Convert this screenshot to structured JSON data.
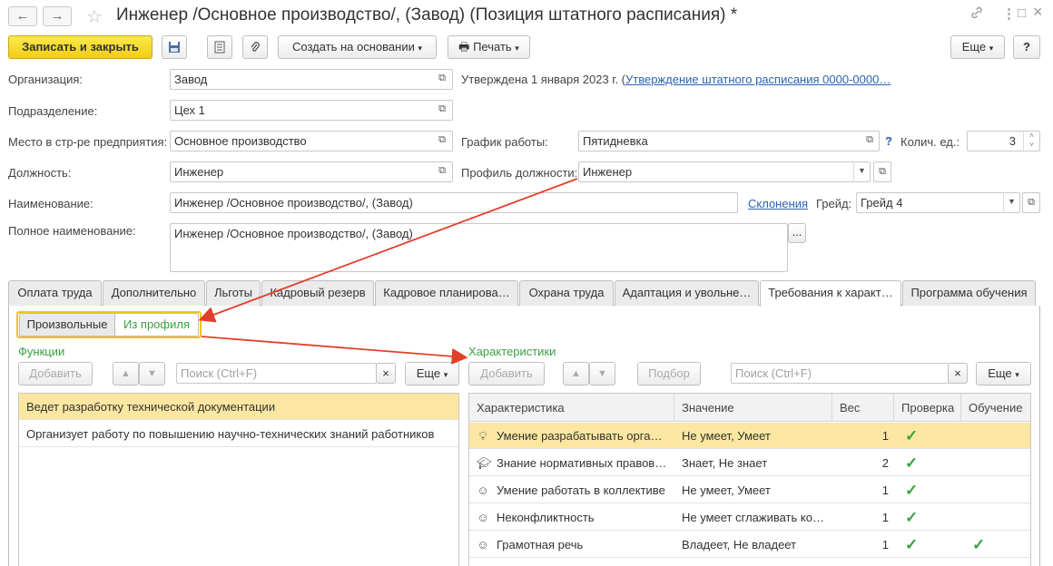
{
  "window": {
    "title": "Инженер /Основное производство/, (Завод) (Позиция штатного расписания) *",
    "back_icon": "←",
    "forward_icon": "→",
    "fav_icon": "☆",
    "link_icon": "🔗",
    "more_icon": "⋮",
    "maximize_icon": "□",
    "close_icon": "×"
  },
  "toolbar": {
    "save_close": "Записать и закрыть",
    "create_based": "Создать на основании",
    "print": "Печать",
    "more": "Еще",
    "help": "?"
  },
  "form": {
    "org_label": "Организация:",
    "org_value": "Завод",
    "approved_text": "Утверждена 1 января 2023 г. (",
    "approved_link": "Утверждение штатного расписания 0000-0000…",
    "dept_label": "Подразделение:",
    "dept_value": "Цех 1",
    "place_label": "Место в стр-ре предприятия:",
    "place_value": "Основное производство",
    "schedule_label": "График работы:",
    "schedule_value": "Пятидневка",
    "units_label": "Колич. ед.:",
    "units_value": "3",
    "position_label": "Должность:",
    "position_value": "Инженер",
    "profile_label": "Профиль должности:",
    "profile_value": "Инженер",
    "name_label": "Наименование:",
    "name_value": "Инженер /Основное производство/, (Завод)",
    "declension_link": "Склонения",
    "grade_label": "Грейд:",
    "grade_value": "Грейд 4",
    "fullname_label": "Полное наименование:",
    "fullname_value": "Инженер /Основное производство/, (Завод)",
    "help_mark": "?"
  },
  "tabs": [
    "Оплата труда",
    "Дополнительно",
    "Льготы",
    "Кадровый резерв",
    "Кадровое планирова…",
    "Охрана труда",
    "Адаптация и увольне…",
    "Требования к характ…",
    "Программа обучения"
  ],
  "switch": {
    "arbitrary": "Произвольные",
    "from_profile": "Из профиля"
  },
  "functions": {
    "title": "Функции",
    "add": "Добавить",
    "search_placeholder": "Поиск (Ctrl+F)",
    "more": "Еще",
    "items": [
      "Ведет разработку технической документации",
      "Организует работу по повышению научно-технических знаний работников"
    ]
  },
  "characteristics": {
    "title": "Характеристики",
    "add": "Добавить",
    "pick": "Подбор",
    "search_placeholder": "Поиск (Ctrl+F)",
    "more": "Еще",
    "columns": [
      "Характеристика",
      "Значение",
      "Вес",
      "Проверка",
      "Обучение"
    ],
    "rows": [
      {
        "icon": "lightbulb-icon",
        "name": "Умение разрабатывать орга…",
        "value": "Не умеет, Умеет",
        "weight": "1",
        "check": true,
        "training": false
      },
      {
        "icon": "graduation-cap-icon",
        "name": "Знание нормативных правов…",
        "value": "Знает, Не знает",
        "weight": "2",
        "check": true,
        "training": false
      },
      {
        "icon": "smiley-icon",
        "name": "Умение работать в коллективе",
        "value": "Не умеет, Умеет",
        "weight": "1",
        "check": true,
        "training": false
      },
      {
        "icon": "smiley-icon",
        "name": "Неконфликтность",
        "value": "Не умеет сглаживать ко…",
        "weight": "1",
        "check": true,
        "training": false
      },
      {
        "icon": "smiley-icon",
        "name": "Грамотная речь",
        "value": "Владеет, Не владеет",
        "weight": "1",
        "check": true,
        "training": true
      }
    ]
  },
  "colors": {
    "accent_green": "#3aa142",
    "primary_yellow": "#f1cd17",
    "selection": "#fbe7a1",
    "arrow_red": "#e0402a",
    "link_blue": "#2b62b8"
  }
}
